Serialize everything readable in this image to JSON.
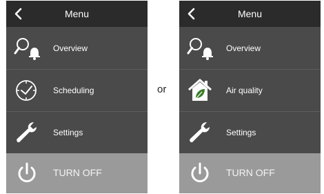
{
  "panels": [
    {
      "header": {
        "back_icon": "chevron-left-icon",
        "title": "Menu"
      },
      "items": [
        {
          "icon": "search-alarm-icon",
          "label": "Overview"
        },
        {
          "icon": "clock-icon",
          "label": "Scheduling"
        },
        {
          "icon": "wrench-icon",
          "label": "Settings"
        },
        {
          "icon": "power-icon",
          "label": "TURN OFF"
        }
      ]
    },
    {
      "header": {
        "back_icon": "chevron-left-icon",
        "title": "Menu"
      },
      "items": [
        {
          "icon": "search-alarm-icon",
          "label": "Overview"
        },
        {
          "icon": "home-leaf-icon",
          "label": "Air quality"
        },
        {
          "icon": "wrench-icon",
          "label": "Settings"
        },
        {
          "icon": "power-icon",
          "label": "TURN OFF"
        }
      ]
    }
  ],
  "separator_text": "or",
  "colors": {
    "header_bg": "#2b2b2b",
    "menu_bg": "#4a4a4a",
    "turn_off_bg": "#9a9a9a",
    "text": "#ffffff",
    "leaf_accent": "#3a7d2a"
  }
}
